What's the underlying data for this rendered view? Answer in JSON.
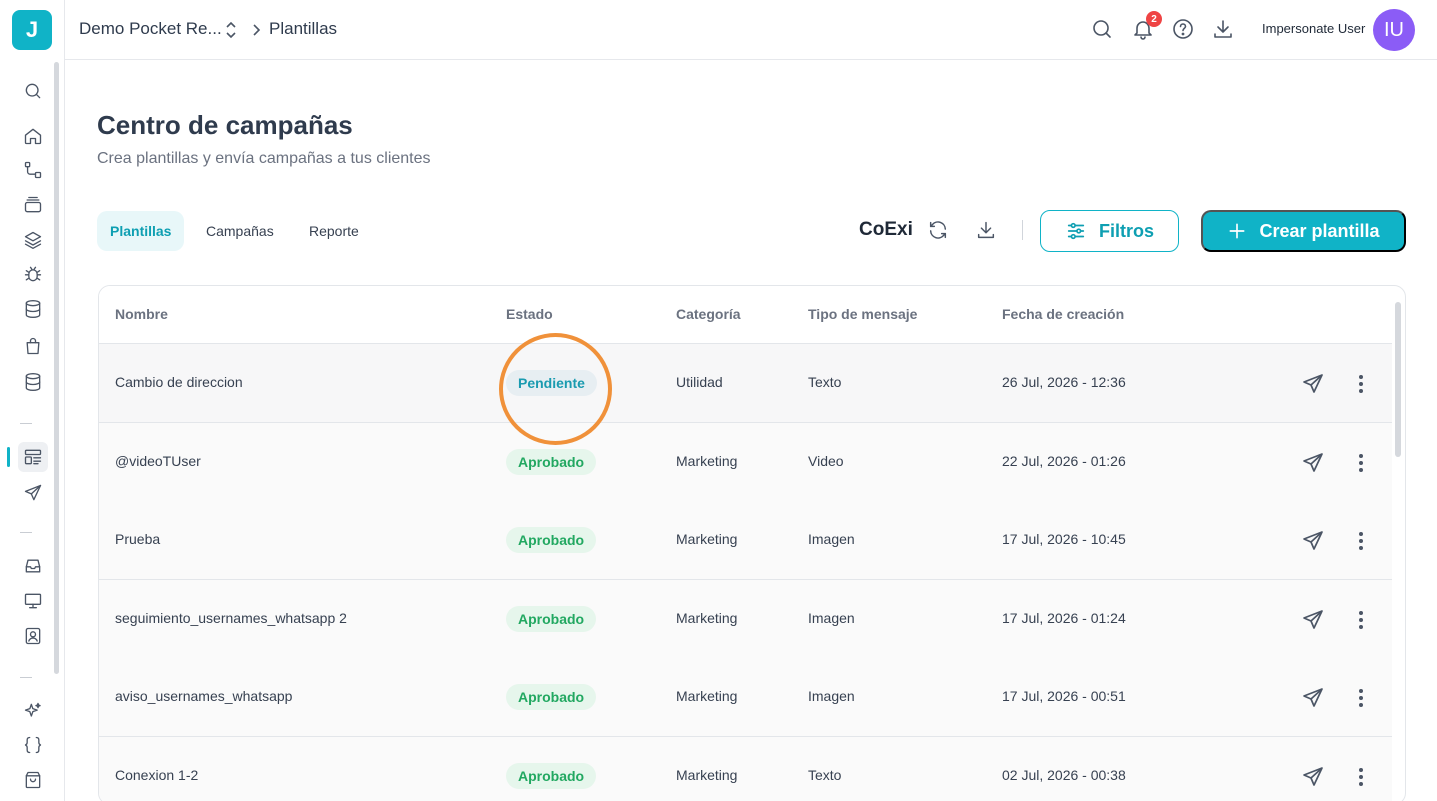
{
  "app": {
    "logo_letter": "J",
    "accent_color": "#10b3c7"
  },
  "sidebar": {
    "items": [
      {
        "icon": "search-icon"
      },
      {
        "icon": "home-icon"
      },
      {
        "icon": "flow-icon"
      },
      {
        "icon": "inbox-stack-icon"
      },
      {
        "icon": "layers-icon"
      },
      {
        "icon": "bug-icon"
      },
      {
        "icon": "database-icon"
      },
      {
        "icon": "shopping-bag-icon"
      },
      {
        "icon": "database-alt-icon"
      },
      {
        "icon": "templates-icon",
        "active": true
      },
      {
        "icon": "send-icon"
      },
      {
        "icon": "inbox-icon"
      },
      {
        "icon": "monitor-icon"
      },
      {
        "icon": "contact-card-icon"
      },
      {
        "icon": "sparkles-icon"
      },
      {
        "icon": "code-braces-icon"
      },
      {
        "icon": "store-bag-icon"
      }
    ]
  },
  "topbar": {
    "org_name": "Demo Pocket Re...",
    "current_page": "Plantillas",
    "notifications_count": "2",
    "user_label": "Impersonate User",
    "avatar_initials": "IU",
    "avatar_color": "#8b5cf6"
  },
  "page": {
    "title": "Centro de campañas",
    "subtitle": "Crea plantillas y envía campañas a tus clientes"
  },
  "tabs": [
    {
      "label": "Plantillas",
      "active": true
    },
    {
      "label": "Campañas",
      "active": false
    },
    {
      "label": "Reporte",
      "active": false
    }
  ],
  "toolbar": {
    "account_label": "CoExi",
    "filters_label": "Filtros",
    "create_label": "Crear plantilla"
  },
  "table": {
    "headers": [
      "Nombre",
      "Estado",
      "Categoría",
      "Tipo de mensaje",
      "Fecha de creación"
    ],
    "rows": [
      {
        "nombre": "Cambio de direccion",
        "estado": "Pendiente",
        "categoria": "Utilidad",
        "tipo": "Texto",
        "fecha": "26 Jul, 2026 - 12:36"
      },
      {
        "nombre": "@videoTUser",
        "estado": "Aprobado",
        "categoria": "Marketing",
        "tipo": "Video",
        "fecha": "22 Jul, 2026 - 01:26"
      },
      {
        "nombre": "Prueba",
        "estado": "Aprobado",
        "categoria": "Marketing",
        "tipo": "Imagen",
        "fecha": "17 Jul, 2026 - 10:45"
      },
      {
        "nombre": "seguimiento_usernames_whatsapp 2",
        "estado": "Aprobado",
        "categoria": "Marketing",
        "tipo": "Imagen",
        "fecha": "17 Jul, 2026 - 01:24"
      },
      {
        "nombre": "aviso_usernames_whatsapp",
        "estado": "Aprobado",
        "categoria": "Marketing",
        "tipo": "Imagen",
        "fecha": "17 Jul, 2026 - 00:51"
      },
      {
        "nombre": "Conexion 1-2",
        "estado": "Aprobado",
        "categoria": "Marketing",
        "tipo": "Texto",
        "fecha": "02 Jul, 2026 - 00:38"
      }
    ]
  },
  "status_colors": {
    "pending": "#1a9bb0",
    "approved": "#22a861",
    "highlight": "#f0913a"
  }
}
